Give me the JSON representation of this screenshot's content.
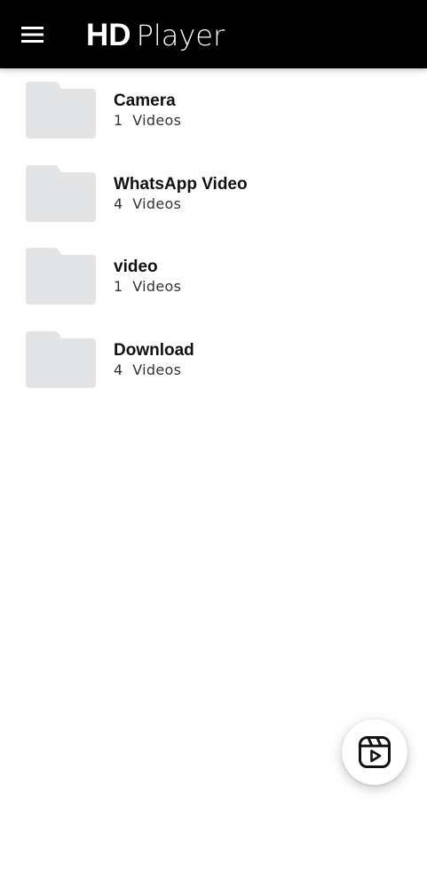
{
  "app_bar": {
    "title_bold": "HD",
    "title_light": "Player",
    "menu_icon": "hamburger-menu-icon",
    "background": "#000000"
  },
  "folders": [
    {
      "name": "Camera",
      "count": "1",
      "count_label": "Videos"
    },
    {
      "name": "WhatsApp Video",
      "count": "4",
      "count_label": "Videos"
    },
    {
      "name": "video",
      "count": "1",
      "count_label": "Videos"
    },
    {
      "name": "Download",
      "count": "4",
      "count_label": "Videos"
    }
  ],
  "fab": {
    "icon": "reels-play-icon"
  },
  "colors": {
    "folder_icon": "#e2e4e5",
    "text_primary": "#111111",
    "text_secondary": "#333333"
  }
}
